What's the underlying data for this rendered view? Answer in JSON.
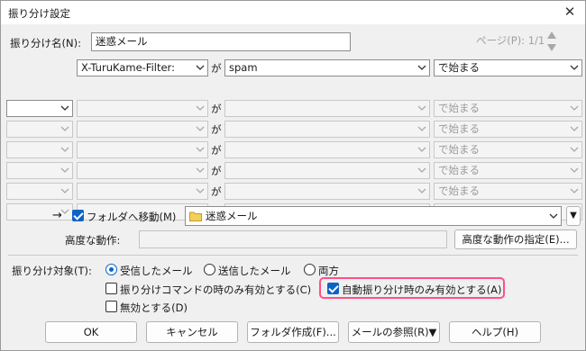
{
  "window": {
    "title": "振り分け設定",
    "close_glyph": "✕"
  },
  "rule_name": {
    "label": "振り分け名(N):",
    "value": "迷惑メール"
  },
  "page_indicator": "ページ(P): 1/1",
  "conditions": [
    {
      "header": "",
      "field": "X-TuruKame-Filter:",
      "particle": "が",
      "value": "spam",
      "match": "で始まる",
      "enabled": true
    },
    {
      "header": "",
      "field": "",
      "particle": "が",
      "value": "",
      "match": "で始まる",
      "enabled": "partial"
    },
    {
      "header": "",
      "field": "",
      "particle": "が",
      "value": "",
      "match": "で始まる",
      "enabled": false
    },
    {
      "header": "",
      "field": "",
      "particle": "が",
      "value": "",
      "match": "で始まる",
      "enabled": false
    },
    {
      "header": "",
      "field": "",
      "particle": "が",
      "value": "",
      "match": "で始まる",
      "enabled": false
    },
    {
      "header": "",
      "field": "",
      "particle": "が",
      "value": "",
      "match": "で始まる",
      "enabled": false
    },
    {
      "header": "",
      "field": "",
      "particle": "が",
      "value": "",
      "match": "で始まる",
      "enabled": false
    }
  ],
  "move": {
    "arrow": "→",
    "checkbox_label": "フォルダへ移動(M)",
    "checked": true,
    "folder": "迷惑メール",
    "dropdown_glyph": "▼"
  },
  "advanced": {
    "label": "高度な動作:",
    "value": "",
    "button": "高度な動作の指定(E)..."
  },
  "target": {
    "label": "振り分け対象(T):",
    "options": [
      "受信したメール",
      "送信したメール",
      "両方"
    ],
    "selected": "受信したメール"
  },
  "options": {
    "command_only": {
      "label": "振り分けコマンドの時のみ有効とする(C)",
      "checked": false
    },
    "auto_only": {
      "label": "自動振り分け時のみ有効とする(A)",
      "checked": true
    },
    "disable": {
      "label": "無効とする(D)",
      "checked": false
    }
  },
  "buttons": {
    "ok": "OK",
    "cancel": "キャンセル",
    "create_folder": "フォルダ作成(F)...",
    "mail_ref": "メールの参照(R)▼",
    "help": "ヘルプ(H)"
  },
  "colors": {
    "accent": "#0a64c8",
    "highlight": "#ff4f86"
  }
}
